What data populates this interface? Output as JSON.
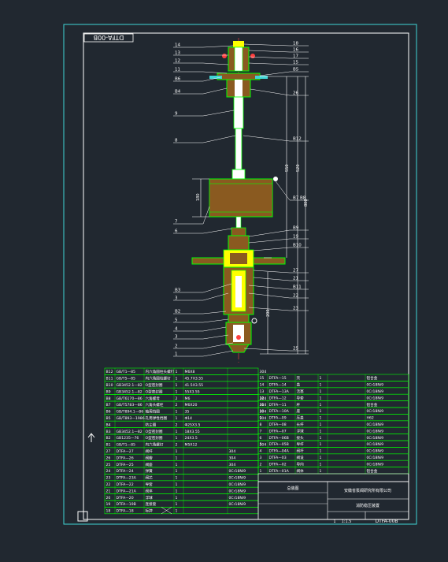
{
  "drawing": {
    "stamp_code": "DTFA-00B",
    "title_block": {
      "company": "安徽省泵阀研究所有限公司",
      "drawing_name": "消防稳压装置",
      "drawing_code": "DTFA-00B",
      "material": "总装图",
      "scale": "1:1.5",
      "sheet": "1"
    },
    "balloons_left": [
      "14",
      "13",
      "12",
      "11",
      "B6",
      "B4",
      "9",
      "8",
      "7",
      "6",
      "B3",
      "3",
      "B2",
      "5",
      "4",
      "3",
      "2",
      "1"
    ],
    "balloons_right": [
      "18",
      "16",
      "17",
      "15",
      "B5",
      "26",
      "B12",
      "B7  B8",
      "B9",
      "19",
      "B10",
      "27",
      "21",
      "B11",
      "22",
      "23",
      "25"
    ],
    "dims": [
      "550",
      "520",
      "800",
      "180",
      "200",
      "40",
      "40"
    ],
    "bom_left": [
      [
        "B12",
        "GB/T1—85",
        "内六角圆柱头螺钉",
        "1",
        "M6X8",
        "",
        "304"
      ],
      [
        "B11",
        "GB/T5—85",
        "内六角圆柱螺钉",
        "1",
        "45.7X3.55",
        "",
        ""
      ],
      [
        "B10",
        "GB3452.1—82",
        "O型密封圈",
        "1",
        "41.5X3.55",
        "",
        ""
      ],
      [
        "B9",
        "GB3452.1—82",
        "O型密封圈",
        "1",
        "55X3.55",
        "",
        ""
      ],
      [
        "B8",
        "GB/T6170—86",
        "六角螺母",
        "2",
        "M6",
        "",
        "304"
      ],
      [
        "B7",
        "GB/T5783—86",
        "六角头螺栓",
        "2",
        "M6X20",
        "",
        "304"
      ],
      [
        "B6",
        "GB/T894.1—86",
        "轴用挡圈",
        "1",
        "35",
        "",
        "304"
      ],
      [
        "B5",
        "GB/T893—1986",
        "孔用弹性挡圈",
        "1",
        "Φ14",
        "",
        "304"
      ],
      [
        "B4",
        "",
        "防尘圈",
        "2",
        "Φ25X3.5",
        "",
        ""
      ],
      [
        "B3",
        "GB3452.1—82",
        "O型密封圈",
        "1",
        "18X3.55",
        "",
        ""
      ],
      [
        "B2",
        "GB1235—76",
        "O型密封圈",
        "1",
        "24X3.5",
        "",
        ""
      ],
      [
        "B1",
        "GB/T1—85",
        "内六角螺钉",
        "2",
        "M5X12",
        "",
        "304"
      ],
      [
        "27",
        "DTFA—27",
        "阀杆",
        "1",
        "",
        "304",
        ""
      ],
      [
        "26",
        "DTFA—26",
        "阀瓣",
        "1",
        "",
        "304",
        ""
      ],
      [
        "25",
        "DTFA—25",
        "阀座",
        "1",
        "",
        "304",
        ""
      ],
      [
        "24",
        "DTFA—24",
        "弹簧",
        "1",
        "",
        "0Cr18Ni9",
        ""
      ],
      [
        "23",
        "DTFA—23A",
        "阀芯",
        "1",
        "",
        "0Cr18Ni9",
        ""
      ],
      [
        "22",
        "DTFA—22",
        "导套",
        "1",
        "",
        "0Cr18Ni9",
        ""
      ],
      [
        "21",
        "DTFA—21A",
        "阀体",
        "1",
        "",
        "0Cr18Ni9",
        ""
      ],
      [
        "20",
        "DTFA—20",
        "浮球",
        "1",
        "",
        "0Cr18Ni9",
        ""
      ],
      [
        "19",
        "DTFA—19B",
        "连接套",
        "1",
        "",
        "0Cr18Ni9",
        ""
      ],
      [
        "18",
        "DTFA—18",
        "标牌",
        "1",
        "",
        "",
        ""
      ]
    ],
    "bom_right": [
      [
        "15",
        "DTFA—15",
        "壳",
        "1",
        "",
        "铝合金"
      ],
      [
        "14",
        "DTFA—14",
        "盖",
        "1",
        "",
        "0Cr18Ni9"
      ],
      [
        "13",
        "DTFA—13A",
        "活塞",
        "1",
        "",
        "0Cr18Ni9"
      ],
      [
        "12",
        "DTFA—12",
        "导套",
        "1",
        "",
        "0Cr18Ni9"
      ],
      [
        "11",
        "DTFA—11",
        "杆",
        "1",
        "",
        "铝合金"
      ],
      [
        "10",
        "DTFA—10A",
        "座",
        "1",
        "",
        "0Cr18Ni9"
      ],
      [
        "9",
        "DTFA—09",
        "压盖",
        "1",
        "",
        "H62"
      ],
      [
        "8",
        "DTFA—08",
        "长杆",
        "1",
        "",
        "0Cr18Ni9"
      ],
      [
        "7",
        "DTFA—07",
        "浮球",
        "1",
        "",
        "0Cr18Ni9"
      ],
      [
        "6",
        "DTFA—06B",
        "接头",
        "1",
        "",
        "0Cr18Ni9"
      ],
      [
        "5",
        "DTFA—05B",
        "导杆",
        "1",
        "",
        "0Cr18Ni9"
      ],
      [
        "4",
        "DTFA—04A",
        "阀杆",
        "1",
        "",
        "0Cr18Ni9"
      ],
      [
        "3",
        "DTFA—03",
        "阀设",
        "1",
        "",
        "0Cr18Ni9"
      ],
      [
        "2",
        "DTFA—02",
        "导向",
        "1",
        "",
        "0Cr18Ni9"
      ],
      [
        "1",
        "DTFA—01A",
        "阀体",
        "1",
        "",
        "铝合金"
      ]
    ]
  }
}
